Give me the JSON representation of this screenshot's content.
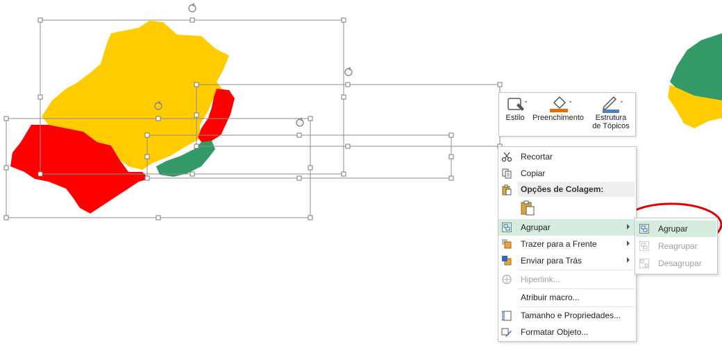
{
  "mini_toolbar": {
    "style": {
      "label": "Estilo",
      "icon": "shape-style-icon"
    },
    "fill": {
      "label": "Preenchimento",
      "icon": "paint-bucket-icon",
      "color": "#E36C0A"
    },
    "outline": {
      "label_line1": "Estrutura",
      "label_line2": "de Tópicos",
      "icon": "pen-outline-icon",
      "color": "#4F81BD"
    }
  },
  "context_menu": {
    "cut": {
      "label": "Recortar",
      "icon": "scissors-icon"
    },
    "copy": {
      "label": "Copiar",
      "icon": "copy-icon"
    },
    "paste_options": {
      "label": "Opções de Colagem:",
      "icon": "paste-icon"
    },
    "group": {
      "label": "Agrupar",
      "icon": "group-icon"
    },
    "bring_front": {
      "label": "Trazer para a Frente",
      "icon": "bring-to-front-icon"
    },
    "send_back": {
      "label": "Enviar para Trás",
      "icon": "send-to-back-icon"
    },
    "hyperlink": {
      "label": "Hiperlink...",
      "icon": "hyperlink-icon"
    },
    "assign_macro": {
      "label": "Atribuir macro..."
    },
    "size_props": {
      "label": "Tamanho e Propriedades...",
      "icon": "size-properties-icon"
    },
    "format_object": {
      "label": "Formatar Objeto...",
      "icon": "format-object-icon"
    }
  },
  "group_submenu": {
    "group": {
      "label": "Agrupar",
      "icon": "group-icon"
    },
    "regroup": {
      "label": "Reagrupar",
      "icon": "regroup-icon"
    },
    "ungroup": {
      "label": "Desagrupar",
      "icon": "ungroup-icon"
    }
  },
  "colors": {
    "yellow": "#FFCC00",
    "red": "#FF0000",
    "green": "#339966",
    "highlight": "#D5ECDE",
    "annotation": "#E00000"
  }
}
